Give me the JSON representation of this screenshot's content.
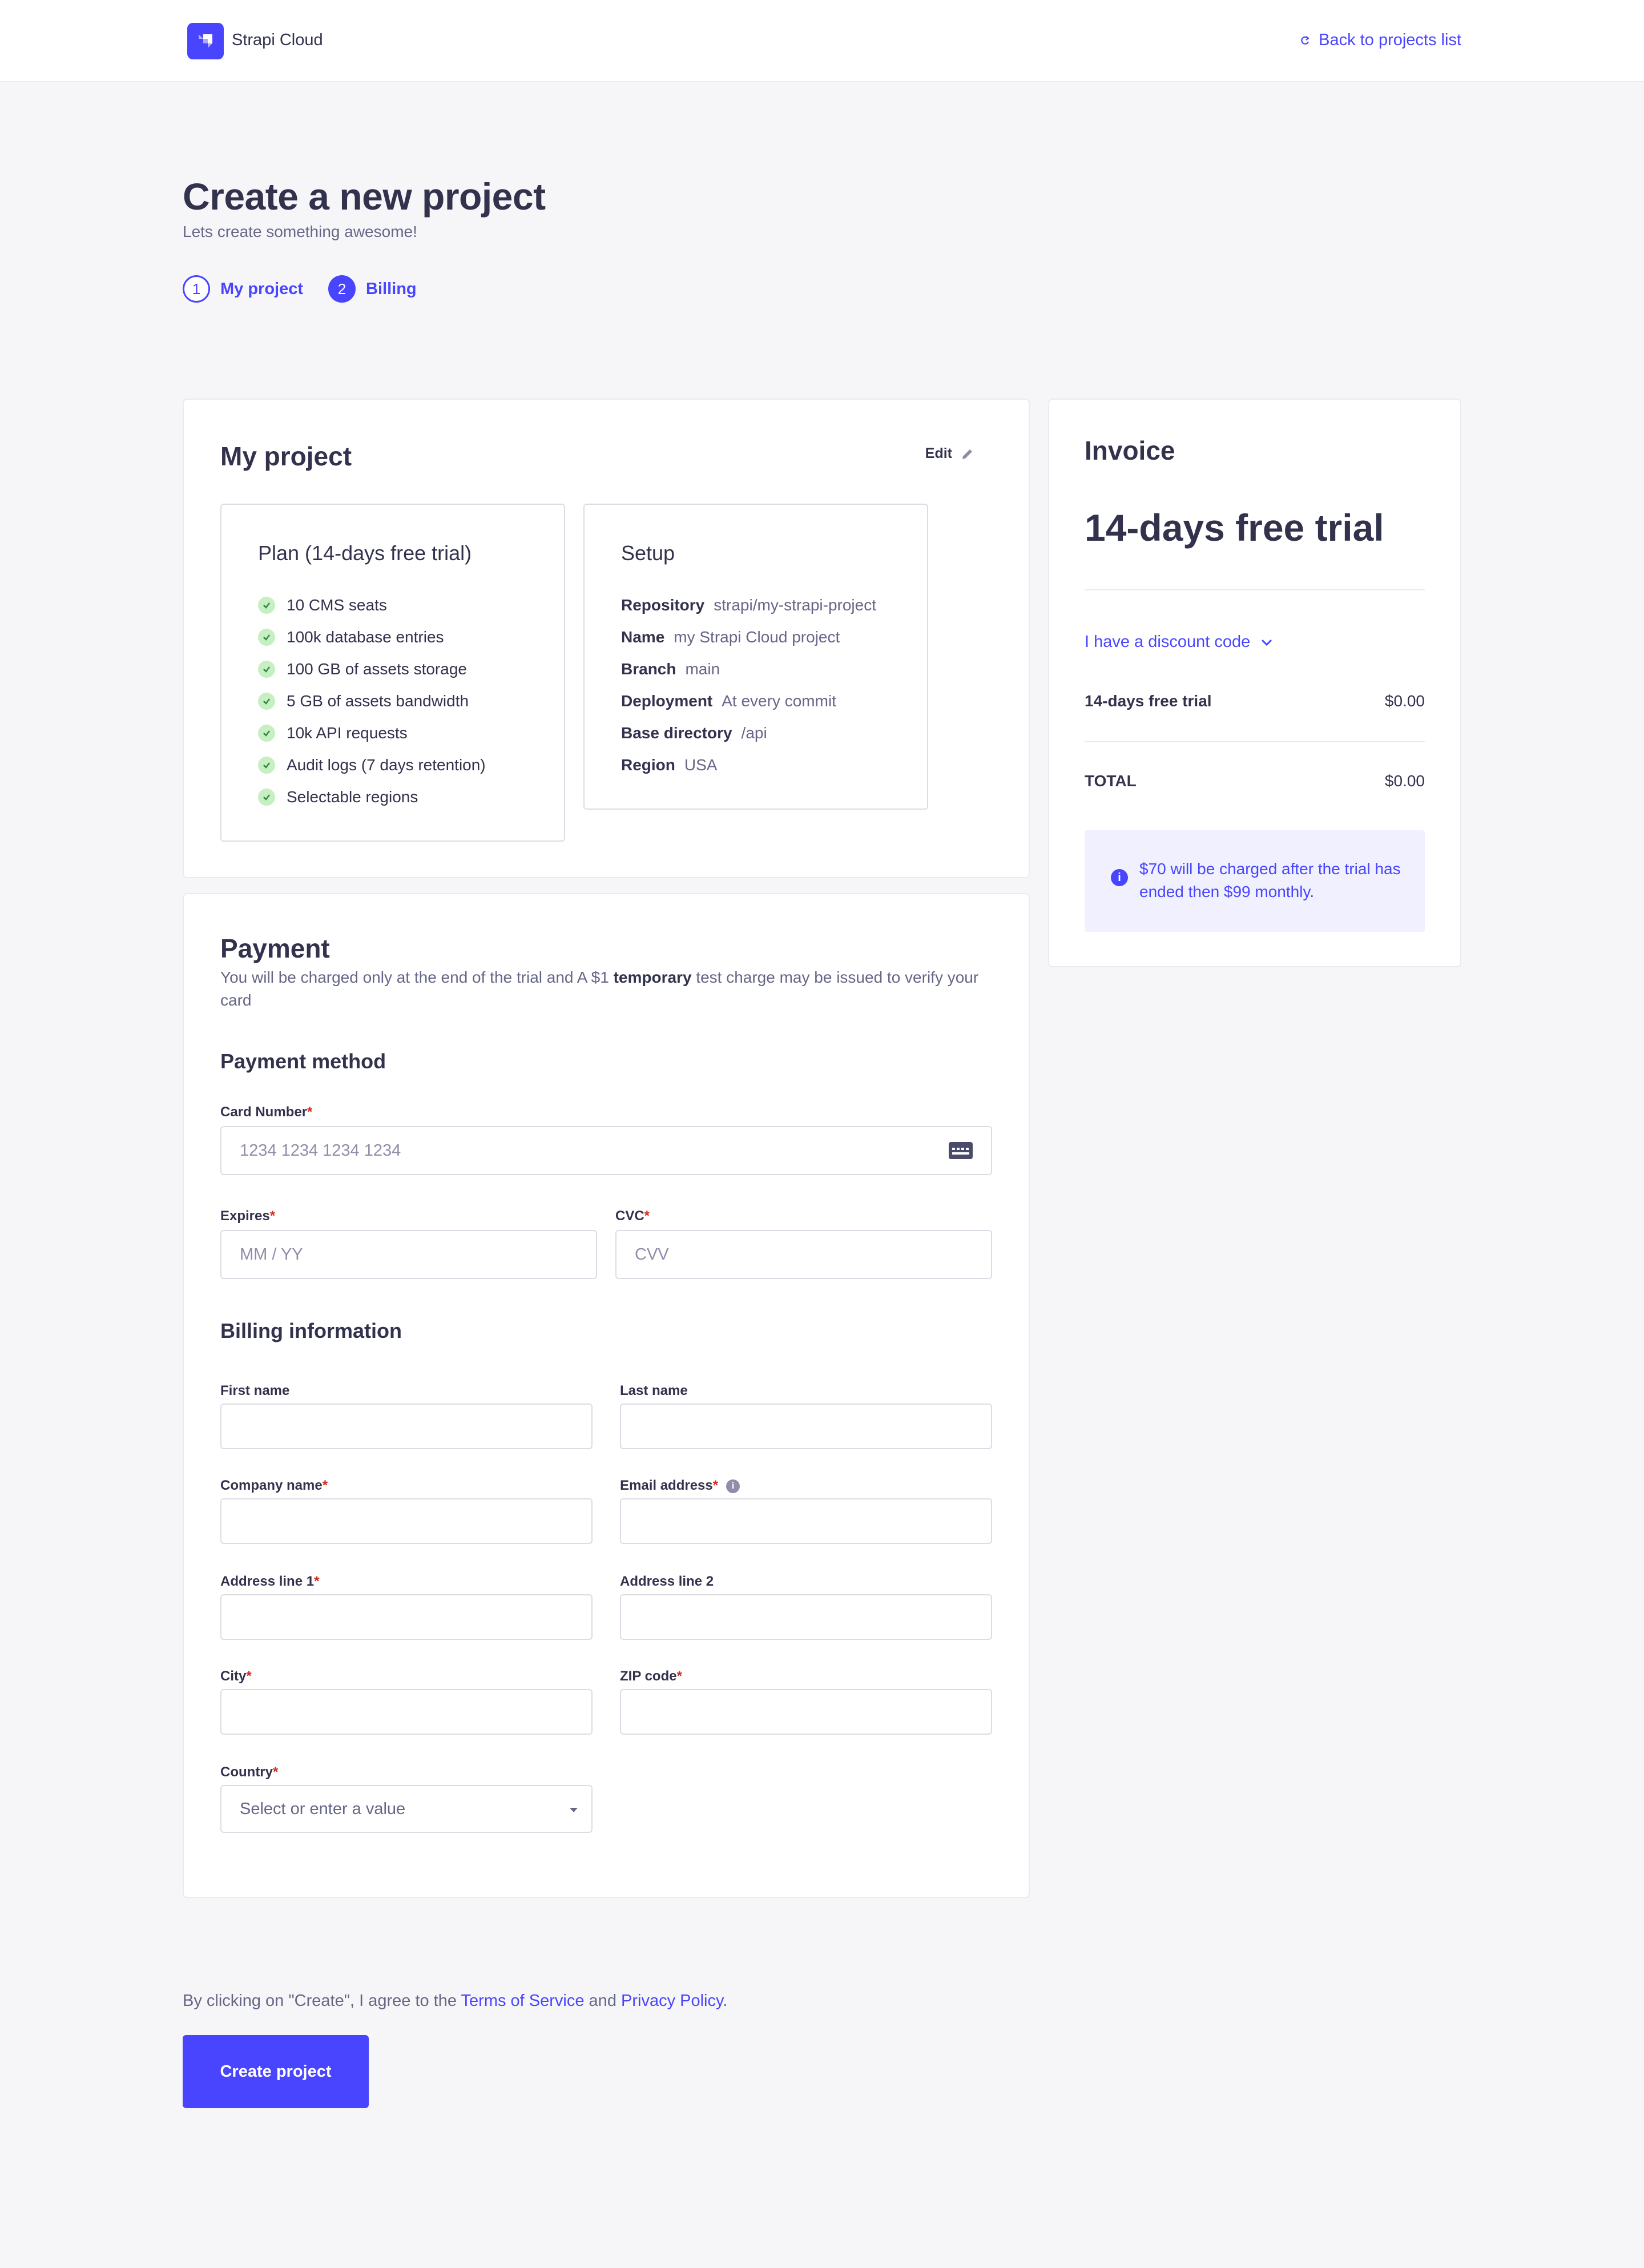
{
  "header": {
    "brand": "Strapi Cloud",
    "back_link": "Back to projects list"
  },
  "page": {
    "title": "Create a new project",
    "subtitle": "Lets create something awesome!",
    "steps": [
      {
        "number": "1",
        "label": "My project"
      },
      {
        "number": "2",
        "label": "Billing"
      }
    ]
  },
  "project": {
    "title": "My project",
    "edit_label": "Edit",
    "plan": {
      "title": "Plan (14-days free trial)",
      "features": [
        "10 CMS seats",
        "100k database entries",
        "100 GB of assets storage",
        "5 GB of assets bandwidth",
        "10k API requests",
        "Audit logs (7 days retention)",
        "Selectable regions"
      ]
    },
    "setup": {
      "title": "Setup",
      "rows": [
        {
          "key": "Repository",
          "value": "strapi/my-strapi-project"
        },
        {
          "key": "Name",
          "value": "my Strapi Cloud project"
        },
        {
          "key": "Branch",
          "value": "main"
        },
        {
          "key": "Deployment",
          "value": "At every commit"
        },
        {
          "key": "Base directory",
          "value": "/api"
        },
        {
          "key": "Region",
          "value": "USA"
        }
      ]
    }
  },
  "payment": {
    "title": "Payment",
    "description_pre": "You will be charged only at the end of the trial and A $1 ",
    "description_bold": "temporary",
    "description_post": " test charge may be issued to verify your card",
    "method_title": "Payment method",
    "card_number_label": "Card Number",
    "card_number_placeholder": "1234 1234 1234 1234",
    "expires_label": "Expires",
    "expires_placeholder": "MM / YY",
    "cvc_label": "CVC",
    "cvc_placeholder": "CVV",
    "billing_title": "Billing information",
    "first_name_label": "First name",
    "last_name_label": "Last name",
    "company_label": "Company name",
    "email_label": "Email address",
    "address1_label": "Address line 1",
    "address2_label": "Address line 2",
    "city_label": "City",
    "zip_label": "ZIP code",
    "country_label": "Country",
    "country_placeholder": "Select or enter a value",
    "required_mark": "*"
  },
  "invoice": {
    "title": "Invoice",
    "plan": "14-days free trial",
    "discount_label": "I have a discount code",
    "line_label": "14-days free trial",
    "line_value": "$0.00",
    "total_label": "TOTAL",
    "total_value": "$0.00",
    "notice": "$70 will be charged after the trial has ended then $99 monthly."
  },
  "footer": {
    "terms_pre": "By clicking on \"Create\", I agree to the ",
    "terms_link": "Terms of Service",
    "terms_mid": " and ",
    "privacy_link": "Privacy Policy",
    "terms_post": ".",
    "create_button": "Create project"
  },
  "colors": {
    "primary": "#4945ff",
    "background": "#f6f6f9",
    "text": "#32324d",
    "muted": "#666687",
    "required": "#d02b20",
    "success_bg": "#c6f0c2",
    "notice_bg": "#f0f0ff"
  }
}
